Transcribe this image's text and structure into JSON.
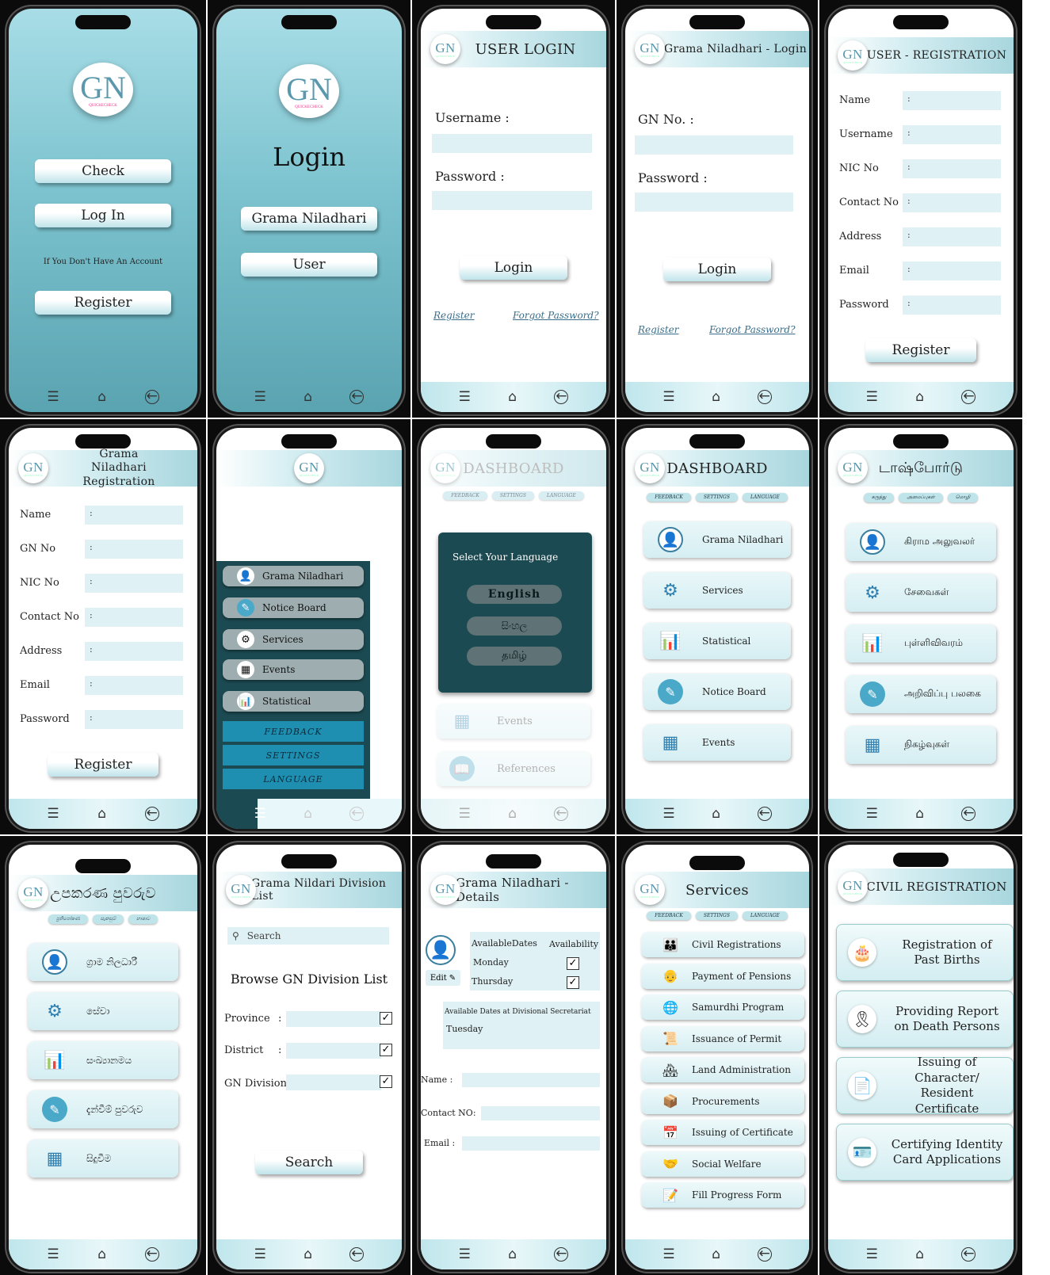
{
  "logo": {
    "letters": "GN",
    "tagline": "QUICKECHECK"
  },
  "nav": {
    "menu_icon": "☰",
    "home_icon": "⌂",
    "back_icon": "←"
  },
  "s1": {
    "check": "Check",
    "login": "Log In",
    "no_account": "If You Don't Have An Account",
    "register": "Register"
  },
  "s2": {
    "title": "Login",
    "gn": "Grama Niladhari",
    "user": "User"
  },
  "s3": {
    "title": "USER LOGIN",
    "username": "Username :",
    "password": "Password  :",
    "login": "Login",
    "register": "Register",
    "forgot": "Forgot Password?"
  },
  "s4": {
    "title": "Grama Niladhari  - Login",
    "gn_no": "GN No.  :",
    "password": "Password  :",
    "login": "Login",
    "register": "Register",
    "forgot": "Forgot Password?"
  },
  "s5": {
    "title": "USER - REGISTRATION",
    "fields": [
      "Name",
      "Username",
      "NIC No",
      "Contact No",
      "Address",
      "Email",
      "Password"
    ],
    "colon": ":",
    "register": "Register"
  },
  "s6": {
    "title": "Grama Niladhari Registration",
    "fields": [
      "Name",
      "GN No",
      "NIC No",
      "Contact No",
      "Address",
      "Email",
      "Password"
    ],
    "colon": ":",
    "register": "Register"
  },
  "s7": {
    "items": [
      "Grama Niladhari",
      "Notice Board",
      "Services",
      "Events",
      "Statistical"
    ],
    "bottom": [
      "FEEDBACK",
      "SETTINGS",
      "LANGUAGE"
    ]
  },
  "s8": {
    "title": "DASHBOARD",
    "tabs": [
      "FEEDBACK",
      "SETTINGS",
      "LANGUAGE"
    ],
    "modal_title": "Select Your Language",
    "languages": [
      "English",
      "සිංහල",
      "தமிழ்"
    ],
    "bg_items": [
      "Events",
      "References"
    ]
  },
  "s9": {
    "title": "DASHBOARD",
    "tabs": [
      "FEEDBACK",
      "SETTINGS",
      "LANGUAGE"
    ],
    "items": [
      "Grama Niladhari",
      "Services",
      "Statistical",
      "Notice Board",
      "Events"
    ]
  },
  "s10": {
    "title": "டாஷ்போர்டு",
    "tabs": [
      "கருத்து",
      "அமைப்புகள்",
      "மொழி"
    ],
    "items": [
      "கிராம அலுவலர்",
      "சேவைகள்",
      "புள்ளிவிவரம்",
      "அறிவிப்பு பலகை",
      "நிகழ்வுகள்"
    ]
  },
  "s11": {
    "title": "උපකරණ පුවරුව",
    "tabs": [
      "ප්‍රතිපෝෂණ",
      "සැකසුම්",
      "භාෂාව"
    ],
    "items": [
      "ග්‍රාම නිලධාරී",
      "සේවා",
      "සංඛ්‍යානමය",
      "දැන්වීම් පුවරුව",
      "සිදුවීම"
    ]
  },
  "s12": {
    "title": "Grama Nildari Division List",
    "search_placeholder": "Search",
    "heading": "Browse GN  Division List",
    "fields": [
      "Province",
      "District",
      "GN Division :"
    ],
    "colon": ":",
    "search_btn": "Search"
  },
  "s13": {
    "title": "Grama Niladhari -Details",
    "edit": "Edit",
    "col_dates": "AvailableDates",
    "col_avail": "Availability",
    "days": [
      "Monday",
      "Thursday"
    ],
    "div_sec": "Available Dates at Divisional Secretariat",
    "div_day": "Tuesday",
    "fields": [
      "Name :",
      "Contact NO:",
      "Email :"
    ]
  },
  "s14": {
    "title": "Services",
    "tabs": [
      "FEEDBACK",
      "SETTINGS",
      "LANGUAGE"
    ],
    "items": [
      "Civil Registrations",
      "Payment of Pensions",
      "Samurdhi Program",
      "Issuance of Permit",
      "Land Administration",
      "Procurements",
      "Issuing of Certificate",
      "Social Welfare",
      "Fill Progress Form"
    ]
  },
  "s15": {
    "title": "CIVIL REGISTRATION",
    "items": [
      "Registration of Past Births",
      "Providing Report on Death Persons",
      "Issuing of Character/ Resident Certificate",
      "Certifying Identity Card Applications"
    ]
  },
  "colors": {
    "accent": "#7cc3cf",
    "dark_modal": "#1c4a52",
    "sidebar_blue": "#1e8fb0"
  }
}
